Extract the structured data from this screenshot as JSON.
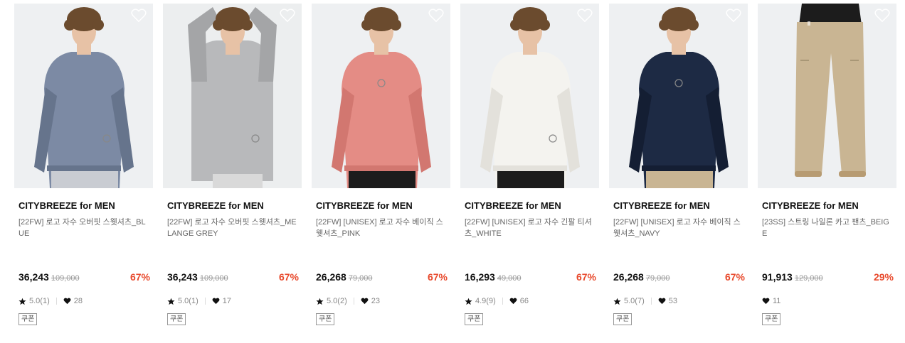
{
  "products": [
    {
      "brand": "CITYBREEZE for MEN",
      "name": "[22FW] 로고 자수 오버핏 스웻셔츠_BLUE",
      "price": "36,243",
      "original_price": "109,000",
      "discount": "67%",
      "rating": "5.0(1)",
      "likes": "28",
      "coupon": "쿠폰",
      "colors": {
        "bg": "#eef0f2",
        "top": "#7c8aa4",
        "top_dark": "#66748c",
        "bottom": "#c9ccd2",
        "hair": "#6b4b2e",
        "skin": "#e7c2a6"
      }
    },
    {
      "brand": "CITYBREEZE for MEN",
      "name": "[22FW] 로고 자수 오버핏 스웻셔츠_MELANGE GREY",
      "price": "36,243",
      "original_price": "109,000",
      "discount": "67%",
      "rating": "5.0(1)",
      "likes": "17",
      "coupon": "쿠폰",
      "colors": {
        "bg": "#eceeef",
        "top": "#b8b9bb",
        "top_dark": "#a4a5a7",
        "bottom": "#d9d9d9",
        "hair": "#6b4b2e",
        "skin": "#e7c2a6"
      }
    },
    {
      "brand": "CITYBREEZE for MEN",
      "name": "[22FW] [UNISEX] 로고 자수 베이직 스웻셔츠_PINK",
      "price": "26,268",
      "original_price": "79,000",
      "discount": "67%",
      "rating": "5.0(2)",
      "likes": "23",
      "coupon": "쿠폰",
      "colors": {
        "bg": "#eef0f2",
        "top": "#e48c85",
        "top_dark": "#d27770",
        "bottom": "#1c1c1c",
        "hair": "#6b4b2e",
        "skin": "#e7c2a6"
      }
    },
    {
      "brand": "CITYBREEZE for MEN",
      "name": "[22FW] [UNISEX] 로고 자수 긴팔 티셔츠_WHITE",
      "price": "16,293",
      "original_price": "49,000",
      "discount": "67%",
      "rating": "4.9(9)",
      "likes": "66",
      "coupon": "쿠폰",
      "colors": {
        "bg": "#eef0f2",
        "top": "#f4f3ef",
        "top_dark": "#e3e1db",
        "bottom": "#1c1c1c",
        "hair": "#6b4b2e",
        "skin": "#e7c2a6"
      }
    },
    {
      "brand": "CITYBREEZE for MEN",
      "name": "[22FW] [UNISEX] 로고 자수 베이직 스웻셔츠_NAVY",
      "price": "26,268",
      "original_price": "79,000",
      "discount": "67%",
      "rating": "5.0(7)",
      "likes": "53",
      "coupon": "쿠폰",
      "colors": {
        "bg": "#eef0f2",
        "top": "#1d2a44",
        "top_dark": "#141e33",
        "bottom": "#c9b593",
        "hair": "#6b4b2e",
        "skin": "#e7c2a6"
      }
    },
    {
      "brand": "CITYBREEZE for MEN",
      "name": "[23SS] 스트링 나일론 카고 팬츠_BEIGE",
      "price": "91,913",
      "original_price": "129,000",
      "discount": "29%",
      "rating": "",
      "likes": "11",
      "coupon": "쿠폰",
      "colors": {
        "bg": "#eef0f2",
        "top": "#1c1c1c",
        "top_dark": "#111111",
        "bottom": "#c9b593",
        "hair": "#6b4b2e",
        "skin": "#e7c2a6"
      }
    }
  ]
}
